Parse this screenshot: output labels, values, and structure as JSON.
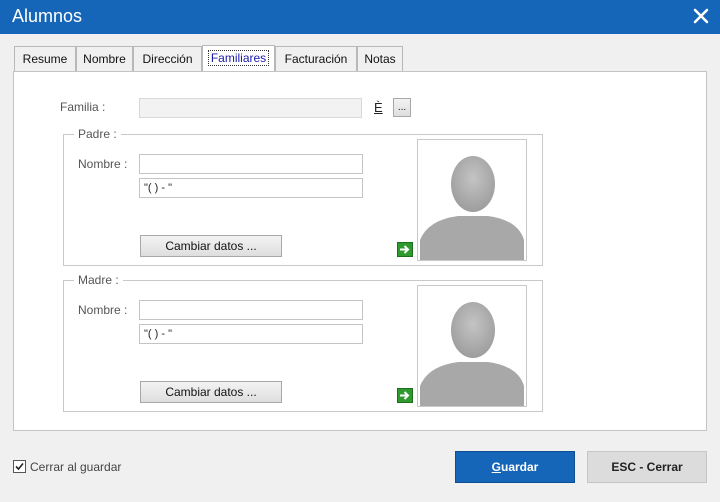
{
  "window": {
    "title": "Alumnos"
  },
  "tabs": [
    {
      "label": "Resume"
    },
    {
      "label": "Nombre"
    },
    {
      "label": "Dirección"
    },
    {
      "label": "Familiares"
    },
    {
      "label": "Facturación"
    },
    {
      "label": "Notas"
    }
  ],
  "active_tab": "Familiares",
  "familia": {
    "label": "Familia :",
    "value": "",
    "glyph": "È",
    "browse_label": "..."
  },
  "padre": {
    "legend": "Padre :",
    "nombre_label": "Nombre :",
    "nombre_value": "",
    "phone_value": "\"(  )    -     \"",
    "change_button": "Cambiar datos ..."
  },
  "madre": {
    "legend": "Madre :",
    "nombre_label": "Nombre :",
    "nombre_value": "",
    "phone_value": "\"(  )    -     \"",
    "change_button": "Cambiar datos ..."
  },
  "footer": {
    "close_on_save_label": "Cerrar al guardar",
    "close_on_save_checked": true,
    "save_first_letter": "G",
    "save_rest": "uardar",
    "esc_label": "ESC - Cerrar"
  },
  "colors": {
    "titlebar": "#1565b8",
    "save_button": "#1565b8",
    "arrow": "#2e9a2e"
  }
}
